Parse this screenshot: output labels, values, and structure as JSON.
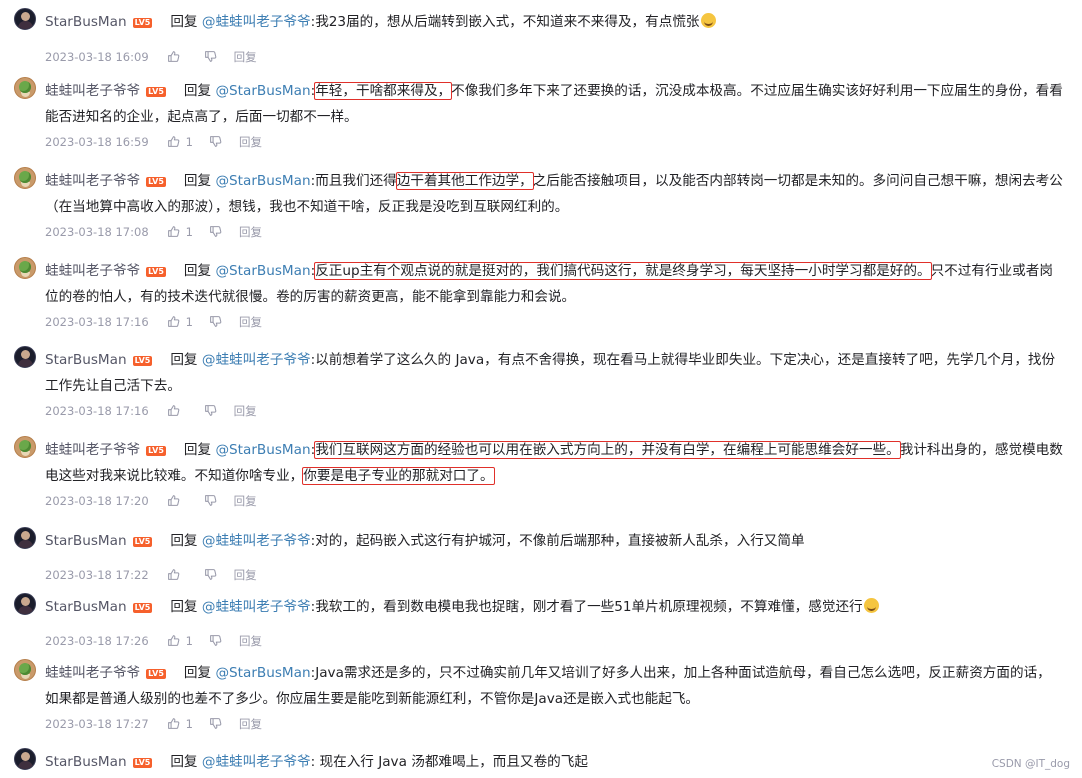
{
  "reply_label": "回复",
  "watermark": "CSDN @IT_dog",
  "comments": [
    {
      "user": "StarBusMan",
      "level": "LV5",
      "mention": "@蛙蛙叫老子爷爷",
      "segments": [
        {
          "text": ":我23届的，想从后端转到嵌入式，不知道来不来得及，有点慌张"
        }
      ],
      "has_emoji": true,
      "time": "2023-03-18 16:09",
      "likes": "",
      "reply_link": "回复"
    },
    {
      "user": "蛙蛙叫老子爷爷",
      "level": "LV5",
      "mention": "@StarBusMan",
      "segments": [
        {
          "text": ":"
        },
        {
          "text": "年轻，干啥都来得及，",
          "hl": true
        },
        {
          "text": "不像我们多年下来了还要换的话，沉没成本极高。不过应届生确实该好好利用一下应届生的身份，看看能否进知名的企业，起点高了，后面一切都不一样。"
        }
      ],
      "time": "2023-03-18 16:59",
      "likes": "1",
      "reply_link": "回复"
    },
    {
      "user": "蛙蛙叫老子爷爷",
      "level": "LV5",
      "mention": "@StarBusMan",
      "segments": [
        {
          "text": ":而且我们还得"
        },
        {
          "text": "边干着其他工作边学，",
          "hl": true
        },
        {
          "text": "之后能否接触项目，以及能否内部转岗一切都是未知的。多问问自己想干嘛，想闲去考公（在当地算中高收入的那波），想钱，我也不知道干啥，反正我是没吃到互联网红利的。"
        }
      ],
      "time": "2023-03-18 17:08",
      "likes": "1",
      "reply_link": "回复"
    },
    {
      "user": "蛙蛙叫老子爷爷",
      "level": "LV5",
      "mention": "@StarBusMan",
      "segments": [
        {
          "text": ":"
        },
        {
          "text": "反正up主有个观点说的就是挺对的，我们搞代码这行，就是终身学习，每天坚持一小时学习都是好的。",
          "hl": true
        },
        {
          "text": "只不过有行业或者岗位的卷的怕人，有的技术迭代就很慢。卷的厉害的薪资更高，能不能拿到靠能力和会说。"
        }
      ],
      "time": "2023-03-18 17:16",
      "likes": "1",
      "reply_link": "回复"
    },
    {
      "user": "StarBusMan",
      "level": "LV5",
      "mention": "@蛙蛙叫老子爷爷",
      "segments": [
        {
          "text": ":以前想着学了这么久的 Java，有点不舍得换，现在看马上就得毕业即失业。下定决心，还是直接转了吧，先学几个月，找份工作先让自己活下去。"
        }
      ],
      "time": "2023-03-18 17:16",
      "likes": "",
      "reply_link": "回复"
    },
    {
      "user": "蛙蛙叫老子爷爷",
      "level": "LV5",
      "mention": "@StarBusMan",
      "segments": [
        {
          "text": ":"
        },
        {
          "text": "我们互联网这方面的经验也可以用在嵌入式方向上的，并没有白学，在编程上可能思维会好一些。",
          "hl": true
        },
        {
          "text": "我计科出身的，感觉模电数电这些对我来说比较难。不知道你啥专业，"
        },
        {
          "text": "你要是电子专业的那就对口了。",
          "hl": true
        }
      ],
      "time": "2023-03-18 17:20",
      "likes": "",
      "reply_link": "回复"
    },
    {
      "user": "StarBusMan",
      "level": "LV5",
      "mention": "@蛙蛙叫老子爷爷",
      "segments": [
        {
          "text": ":对的，起码嵌入式这行有护城河，不像前后端那种，直接被新人乱杀，入行又简单"
        }
      ],
      "time": "2023-03-18 17:22",
      "likes": "",
      "reply_link": "回复"
    },
    {
      "user": "StarBusMan",
      "level": "LV5",
      "mention": "@蛙蛙叫老子爷爷",
      "segments": [
        {
          "text": ":我软工的，看到数电模电我也捉瞎，刚才看了一些51单片机原理视频，不算难懂，感觉还行"
        }
      ],
      "has_emoji": true,
      "time": "2023-03-18 17:26",
      "likes": "1",
      "reply_link": "回复"
    },
    {
      "user": "蛙蛙叫老子爷爷",
      "level": "LV5",
      "mention": "@StarBusMan",
      "segments": [
        {
          "text": ":Java需求还是多的，只不过确实前几年又培训了好多人出来，加上各种面试造航母，看自己怎么选吧，反正薪资方面的话，如果都是普通人级别的也差不了多少。你应届生要是能吃到新能源红利，不管你是Java还是嵌入式也能起飞。"
        }
      ],
      "time": "2023-03-18 17:27",
      "likes": "1",
      "reply_link": "回复"
    },
    {
      "user": "StarBusMan",
      "level": "LV5",
      "mention": "@蛙蛙叫老子爷爷",
      "segments": [
        {
          "text": ": 现在入行 Java 汤都难喝上，而且又卷的飞起"
        }
      ],
      "time": "",
      "likes": "",
      "reply_link": ""
    }
  ]
}
